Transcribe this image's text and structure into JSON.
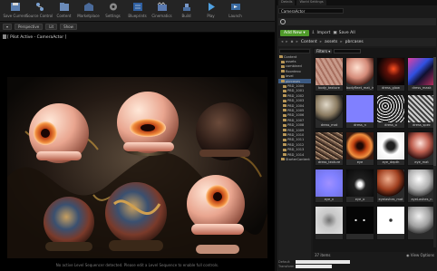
{
  "toolbar": {
    "buttons": [
      {
        "label": "Save Current",
        "icon": "save-icon"
      },
      {
        "label": "Source Control",
        "icon": "source-control-icon"
      },
      {
        "label": "Content",
        "icon": "content-icon"
      },
      {
        "label": "Marketplace",
        "icon": "marketplace-icon"
      },
      {
        "label": "Settings",
        "icon": "settings-icon"
      },
      {
        "label": "Blueprints",
        "icon": "blueprints-icon"
      },
      {
        "label": "Cinematics",
        "icon": "cinematics-icon"
      },
      {
        "label": "Build",
        "icon": "build-icon"
      },
      {
        "label": "Play",
        "icon": "play-icon"
      },
      {
        "label": "Launch",
        "icon": "launch-icon"
      }
    ]
  },
  "viewport": {
    "chips": [
      "Perspective",
      "Lit",
      "Show"
    ],
    "pilot_label": "[ Pilot Active - CameraActor ]",
    "message": "No active Level Sequencer detected. Please edit a Level Sequence to enable full controls."
  },
  "panel": {
    "tabs": [
      "Details",
      "World Settings"
    ],
    "search_value": "CameraActor",
    "content_browser": {
      "add_new": "Add New",
      "import": "Import",
      "save_all": "Save All",
      "path": [
        "Content",
        "assets",
        "pbrcases"
      ],
      "filters_label": "Filters",
      "tree": [
        {
          "label": "Content",
          "level": 0,
          "selected": false
        },
        {
          "label": "assets",
          "level": 1,
          "selected": false
        },
        {
          "label": "combined",
          "level": 1,
          "selected": false
        },
        {
          "label": "floordeco",
          "level": 1,
          "selected": false
        },
        {
          "label": "level",
          "level": 1,
          "selected": false
        },
        {
          "label": "pbrcases",
          "level": 1,
          "selected": true
        },
        {
          "label": "PBD_1000",
          "level": 2,
          "selected": false
        },
        {
          "label": "PBD_1001",
          "level": 2,
          "selected": false
        },
        {
          "label": "PBD_1002",
          "level": 2,
          "selected": false
        },
        {
          "label": "PBD_1003",
          "level": 2,
          "selected": false
        },
        {
          "label": "PBD_1004",
          "level": 2,
          "selected": false
        },
        {
          "label": "PBD_1005",
          "level": 2,
          "selected": false
        },
        {
          "label": "PBD_1006",
          "level": 2,
          "selected": false
        },
        {
          "label": "PBD_1007",
          "level": 2,
          "selected": false
        },
        {
          "label": "PBD_1008",
          "level": 2,
          "selected": false
        },
        {
          "label": "PBD_1009",
          "level": 2,
          "selected": false
        },
        {
          "label": "PBD_1010",
          "level": 2,
          "selected": false
        },
        {
          "label": "PBD_1011",
          "level": 2,
          "selected": false
        },
        {
          "label": "PBD_1012",
          "level": 2,
          "selected": false
        },
        {
          "label": "PBD_1013",
          "level": 2,
          "selected": false
        },
        {
          "label": "PBD_1014",
          "level": 2,
          "selected": false
        },
        {
          "label": "StarterContent",
          "level": 1,
          "selected": false
        }
      ],
      "assets": [
        {
          "label": "body_texture",
          "kind": "skin"
        },
        {
          "label": "bodyfleet_mat_inst",
          "kind": "skinsphere"
        },
        {
          "label": "dress_glow",
          "kind": "darkred"
        },
        {
          "label": "dress_mask",
          "kind": "mask"
        },
        {
          "label": "dress_mat",
          "kind": "gold"
        },
        {
          "label": "dress_n",
          "kind": "normal"
        },
        {
          "label": "dress_o",
          "kind": "speckle"
        },
        {
          "label": "dress_spec",
          "kind": "grey"
        },
        {
          "label": "dress_texture",
          "kind": "fabric"
        },
        {
          "label": "eye",
          "kind": "eyeorange"
        },
        {
          "label": "eye_depth",
          "kind": "eyedepth"
        },
        {
          "label": "eye_mat",
          "kind": "eyesphere"
        },
        {
          "label": "eye_n",
          "kind": "normal2"
        },
        {
          "label": "eye_o",
          "kind": "eyeo"
        },
        {
          "label": "eyelashes_mat",
          "kind": "lashes"
        },
        {
          "label": "eyeLashes_n",
          "kind": "whitegrey"
        },
        {
          "label": "",
          "kind": "greyball"
        },
        {
          "label": "",
          "kind": "darkeyes"
        },
        {
          "label": "",
          "kind": "whitedots"
        },
        {
          "label": "",
          "kind": "greysphere"
        }
      ],
      "status_count": "37 items",
      "view_options": "View Options"
    },
    "details": [
      {
        "label": "Default"
      },
      {
        "label": "Transform"
      }
    ]
  },
  "colors": {
    "accent_green": "#4f9a2a",
    "folder": "#b69556",
    "selection": "#3c5a82"
  }
}
